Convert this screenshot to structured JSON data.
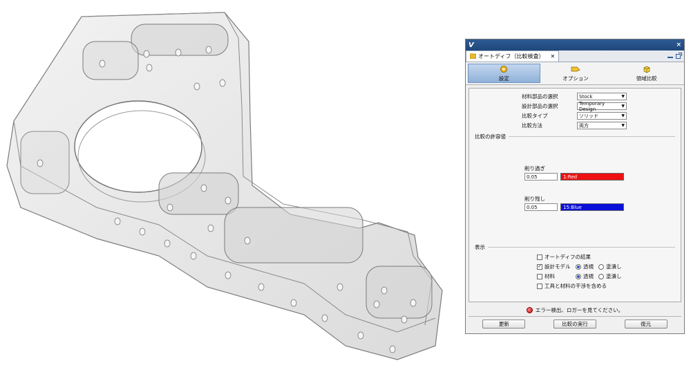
{
  "window": {
    "logo": "V",
    "close_glyph": "×"
  },
  "tab": {
    "title": "オートディフ（比較検査）",
    "close_glyph": "✕"
  },
  "ribbon": [
    {
      "label": "設定",
      "icon": "gear-icon",
      "active": true
    },
    {
      "label": "オプション",
      "icon": "tool-icon",
      "active": false
    },
    {
      "label": "領域比較",
      "icon": "box-icon",
      "active": false
    }
  ],
  "settings": {
    "stock_label": "材料部品の選択",
    "stock_value": "Stock",
    "design_label": "設計部品の選択",
    "design_value": "Temporary Design",
    "type_label": "比較タイプ",
    "type_value": "ソリッド",
    "method_label": "比較方法",
    "method_value": "両方"
  },
  "tolerance": {
    "section_title": "比較の許容値",
    "over_label": "削り過ぎ",
    "over_value": "0.05",
    "over_color_name": "1:Red",
    "over_color": "#ee1111",
    "under_label": "削り残し",
    "under_value": "0.05",
    "under_color_name": "15:Blue",
    "under_color": "#0a10d8"
  },
  "display": {
    "section_title": "表示",
    "autodiff_result": "オートディフの結果",
    "design_model": "設計モデル",
    "stock": "材料",
    "transparent": "透視",
    "filled": "塗潰し",
    "include_collision": "工具と材料の干渉を含める"
  },
  "status": {
    "message": "エラー検出、ロガーを見てください。",
    "color": "#c00000"
  },
  "buttons": {
    "update": "更新",
    "run": "比較の実行",
    "restore": "復元"
  }
}
